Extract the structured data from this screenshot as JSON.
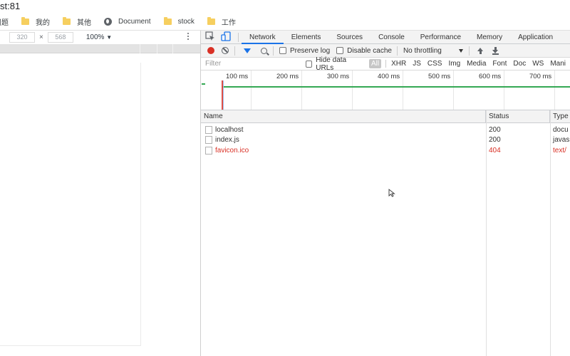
{
  "page": {
    "url_fragment": "st:81"
  },
  "bookmarks": [
    {
      "label": "问题",
      "icon": "folder-icon"
    },
    {
      "label": "我的",
      "icon": "folder-icon"
    },
    {
      "label": "其他",
      "icon": "folder-icon"
    },
    {
      "label": "Document",
      "icon": "globe-icon"
    },
    {
      "label": "stock",
      "icon": "folder-icon"
    },
    {
      "label": "工作",
      "icon": "folder-icon"
    }
  ],
  "device_toolbar": {
    "width": "320",
    "height": "568",
    "times": "×",
    "zoom": "100%"
  },
  "devtools": {
    "tabs": [
      "Network",
      "Elements",
      "Sources",
      "Console",
      "Performance",
      "Memory",
      "Application"
    ],
    "active_tab": "Network",
    "toolbar": {
      "preserve_log": "Preserve log",
      "disable_cache": "Disable cache",
      "throttling": "No throttling"
    },
    "filter": {
      "placeholder": "Filter",
      "hide_data_urls": "Hide data URLs",
      "types": [
        "All",
        "XHR",
        "JS",
        "CSS",
        "Img",
        "Media",
        "Font",
        "Doc",
        "WS",
        "Mani"
      ],
      "active_type": "All"
    },
    "timeline": {
      "ticks": [
        "100 ms",
        "200 ms",
        "300 ms",
        "400 ms",
        "500 ms",
        "600 ms",
        "700 ms"
      ]
    },
    "grid": {
      "columns": {
        "name": "Name",
        "status": "Status",
        "type": "Type"
      },
      "rows": [
        {
          "name": "localhost",
          "status": "200",
          "type": "docu",
          "error": false
        },
        {
          "name": "index.js",
          "status": "200",
          "type": "javas",
          "error": false
        },
        {
          "name": "favicon.ico",
          "status": "404",
          "type": "text/",
          "error": true
        }
      ]
    },
    "colors": {
      "record": "#d93025",
      "active_tab": "#1a73e8",
      "error": "#d93025",
      "timeline_green": "#34a853"
    }
  }
}
